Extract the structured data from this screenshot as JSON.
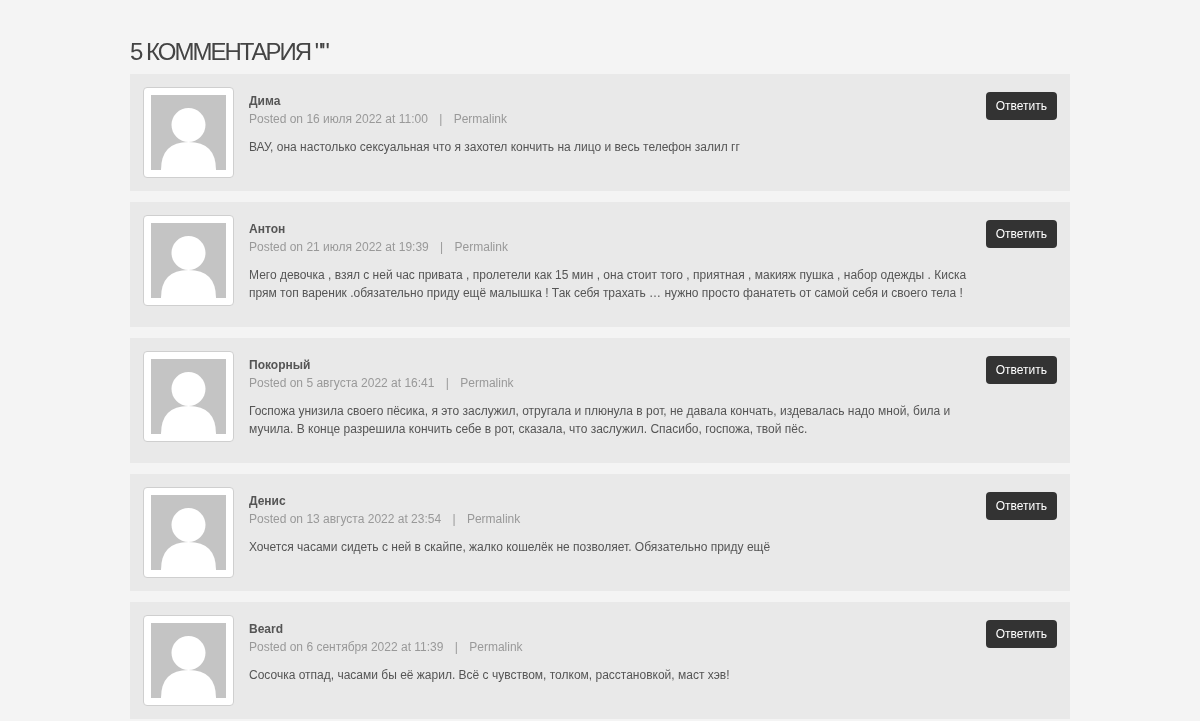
{
  "heading": "5 КОММЕНТАРИЯ \"\"",
  "comments": [
    {
      "author": "Дима",
      "posted": "Posted on 16 июля 2022 at 11:00",
      "separator": "|",
      "permalink": "Permalink",
      "reply": "Ответить",
      "text": "ВАУ, она настолько сексуальная что я захотел кончить на лицо и весь телефон залил гг"
    },
    {
      "author": "Антон",
      "posted": "Posted on 21 июля 2022 at 19:39",
      "separator": "|",
      "permalink": "Permalink",
      "reply": "Ответить",
      "text": "Мего девочка , взял с ней час привата , пролетели как 15 мин , она стоит того , приятная , макияж пушка , набор одежды . Киска прям топ вареник .обязательно приду ещё малышка ! Так себя трахать … нужно просто фанатеть от самой себя и своего тела !"
    },
    {
      "author": "Покорный",
      "posted": "Posted on 5 августа 2022 at 16:41",
      "separator": "|",
      "permalink": "Permalink",
      "reply": "Ответить",
      "text": "Госпожа унизила своего пёсика, я это заслужил, отругала и плюнула в рот, не давала кончать, издевалась надо мной, била и мучила. В конце разрешила кончить себе в рот, сказала, что заслужил. Спасибо, госпожа, твой пёс."
    },
    {
      "author": "Денис",
      "posted": "Posted on 13 августа 2022 at 23:54",
      "separator": "|",
      "permalink": "Permalink",
      "reply": "Ответить",
      "text": "Хочется часами сидеть с ней в скайпе, жалко кошелёк не позволяет. Обязательно приду ещё"
    },
    {
      "author": "Beard",
      "posted": "Posted on 6 сентября 2022 at 11:39",
      "separator": "|",
      "permalink": "Permalink",
      "reply": "Ответить",
      "text": "Сосочка отпад, часами бы её жарил. Всё с чувством, толком, расстановкой, маст хэв!"
    }
  ]
}
